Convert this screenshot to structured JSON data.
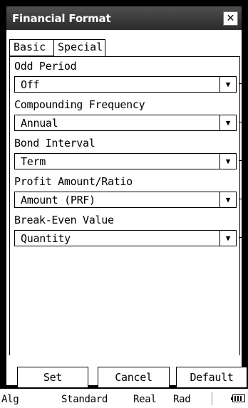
{
  "window": {
    "title": "Financial Format",
    "close_glyph": "✕"
  },
  "tabs": [
    {
      "label": "Basic",
      "active": false
    },
    {
      "label": "Special",
      "active": true
    }
  ],
  "fields": [
    {
      "label": "Odd Period",
      "value": "Off"
    },
    {
      "label": "Compounding Frequency",
      "value": "Annual"
    },
    {
      "label": "Bond Interval",
      "value": "Term"
    },
    {
      "label": "Profit Amount/Ratio",
      "value": "Amount (PRF)"
    },
    {
      "label": "Break-Even Value",
      "value": "Quantity"
    }
  ],
  "dropdown_arrow": "▼",
  "buttons": {
    "set": "Set",
    "cancel": "Cancel",
    "default": "Default"
  },
  "status_bar": {
    "mode": "Alg",
    "display": "Standard",
    "number": "Real",
    "angle": "Rad"
  },
  "icons": {
    "close": "close-icon",
    "dropdown": "chevron-down-icon",
    "battery": "battery-icon"
  }
}
